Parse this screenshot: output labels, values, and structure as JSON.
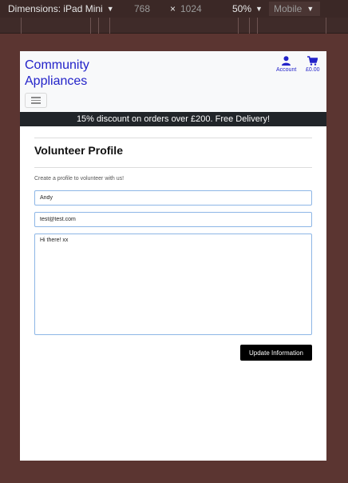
{
  "toolbar": {
    "dimensions_label": "Dimensions: iPad Mini",
    "width": "768",
    "times": "×",
    "height": "1024",
    "zoom": "50%",
    "mode": "Mobile"
  },
  "header": {
    "brand_line1": "Community",
    "brand_line2": "Appliances",
    "account_label": "Account",
    "account_icon": "user-icon",
    "cart_label": "£0.00",
    "cart_icon": "shopping-cart-icon",
    "menu_icon": "hamburger-icon"
  },
  "banner": {
    "text": "15% discount on orders over £200. Free Delivery!"
  },
  "main": {
    "title": "Volunteer Profile",
    "intro": "Create a profile to volunteer with us!",
    "name_value": "Andy",
    "email_value": "test@test.com",
    "message_value": "Hi there! xx",
    "submit_label": "Update Information"
  },
  "colors": {
    "link": "#2323c9",
    "banner_bg": "#212529",
    "field_border": "#8db6e6",
    "button_bg": "#000000"
  }
}
